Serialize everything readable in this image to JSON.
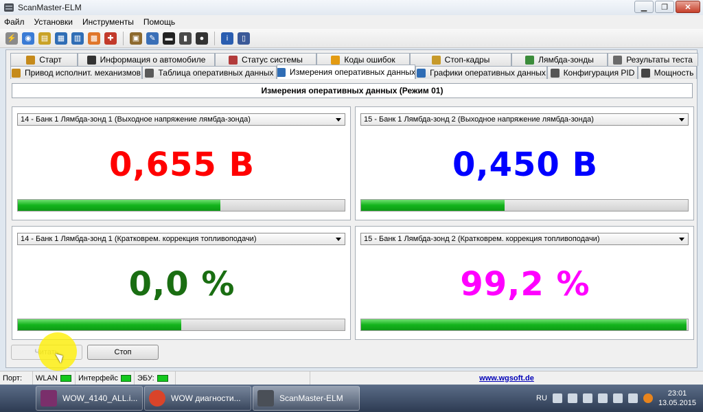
{
  "window": {
    "title": "ScanMaster-ELM"
  },
  "menu": [
    "Файл",
    "Установки",
    "Инструменты",
    "Помощь"
  ],
  "toolbar_icons": [
    {
      "name": "connect-icon",
      "color": "#8a8a8a",
      "glyph": "⚡"
    },
    {
      "name": "globe-icon",
      "color": "#3a7bd5",
      "glyph": "◉"
    },
    {
      "name": "document-icon",
      "color": "#c9a227",
      "glyph": "▤"
    },
    {
      "name": "table-icon",
      "color": "#2f6db5",
      "glyph": "▦"
    },
    {
      "name": "graph-icon",
      "color": "#2f6db5",
      "glyph": "▥"
    },
    {
      "name": "dashboard-icon",
      "color": "#e0762b",
      "glyph": "▩"
    },
    {
      "name": "wrench-icon",
      "color": "#c23a2b",
      "glyph": "✚"
    },
    {
      "name": "clipboard-icon",
      "color": "#8d6a2f",
      "glyph": "▣"
    },
    {
      "name": "chat-icon",
      "color": "#3a6fb7",
      "glyph": "✎"
    },
    {
      "name": "terminal-icon",
      "color": "#222222",
      "glyph": "▬"
    },
    {
      "name": "battery-icon",
      "color": "#4a4a4a",
      "glyph": "▮"
    },
    {
      "name": "bomb-icon",
      "color": "#333333",
      "glyph": "●"
    },
    {
      "name": "info-icon",
      "color": "#2a5db0",
      "glyph": "i"
    },
    {
      "name": "book-icon",
      "color": "#3b5998",
      "glyph": "▯"
    }
  ],
  "tabs_top": [
    {
      "label": "Старт",
      "icon": "start-icon",
      "color": "#c58a1b"
    },
    {
      "label": "Информация о автомобиле",
      "icon": "info-icon",
      "color": "#333333"
    },
    {
      "label": "Статус системы",
      "icon": "status-icon",
      "color": "#b23b3b"
    },
    {
      "label": "Коды ошибок",
      "icon": "warning-icon",
      "color": "#e39b12"
    },
    {
      "label": "Стоп-кадры",
      "icon": "freeze-frame-icon",
      "color": "#c79a2a"
    },
    {
      "label": "Лямбда-зонды",
      "icon": "lambda-icon",
      "color": "#3b8c3b"
    },
    {
      "label": "Результаты теста",
      "icon": "gear-icon",
      "color": "#6a6a6a"
    }
  ],
  "tabs_bottom": [
    {
      "label": "Привод исполнит. механизмов",
      "icon": "actuator-icon",
      "color": "#c58a1b"
    },
    {
      "label": "Таблица оперативных данных",
      "icon": "table-icon",
      "color": "#5a5a5a"
    },
    {
      "label": "Измерения оперативных данных",
      "icon": "measure-icon",
      "color": "#2f6db5",
      "active": true
    },
    {
      "label": "Графики оперативных данных",
      "icon": "graph-icon",
      "color": "#2f6db5"
    },
    {
      "label": "Конфигурация PID",
      "icon": "config-icon",
      "color": "#555555"
    },
    {
      "label": "Мощность",
      "icon": "power-icon",
      "color": "#444444"
    }
  ],
  "page_title": "Измерения оперативных данных (Режим 01)",
  "gauges": [
    {
      "select": "14 - Банк 1 Лямбда-зонд 1 (Выходное напряжение лямбда-зонда)",
      "value": "0,655 В",
      "color": "#ff0000",
      "fill": 0.62
    },
    {
      "select": "15 - Банк 1 Лямбда-зонд 2 (Выходное напряжение лямбда-зонда)",
      "value": "0,450 В",
      "color": "#0000ff",
      "fill": 0.44
    },
    {
      "select": "14 - Банк 1 Лямбда-зонд 1 (Кратковрем. коррекция топливоподачи)",
      "value": "0,0 %",
      "color": "#1a6e12",
      "fill": 0.5
    },
    {
      "select": "15 - Банк 1 Лямбда-зонд 2 (Кратковрем. коррекция топливоподачи)",
      "value": "99,2 %",
      "color": "#ff00ff",
      "fill": 0.996
    }
  ],
  "buttons": {
    "read": "Читать",
    "stop": "Стоп"
  },
  "status": {
    "port_label": "Порт:",
    "wlan_label": "WLAN",
    "interface_label": "Интерфейс",
    "ecu_label": "ЭБУ:",
    "link": "www.wgsoft.de"
  },
  "taskbar": {
    "tasks": [
      {
        "label": "WOW_4140_ALL.i...",
        "icon": "winrar-icon",
        "color": "#7a2f6b"
      },
      {
        "label": "WOW диагности...",
        "icon": "chrome-icon",
        "color": "#d9442a"
      },
      {
        "label": "ScanMaster-ELM",
        "icon": "scanmaster-icon",
        "color": "#4a4f57",
        "active": true
      }
    ],
    "lang": "RU",
    "time": "23:01",
    "date": "13.05.2015"
  }
}
